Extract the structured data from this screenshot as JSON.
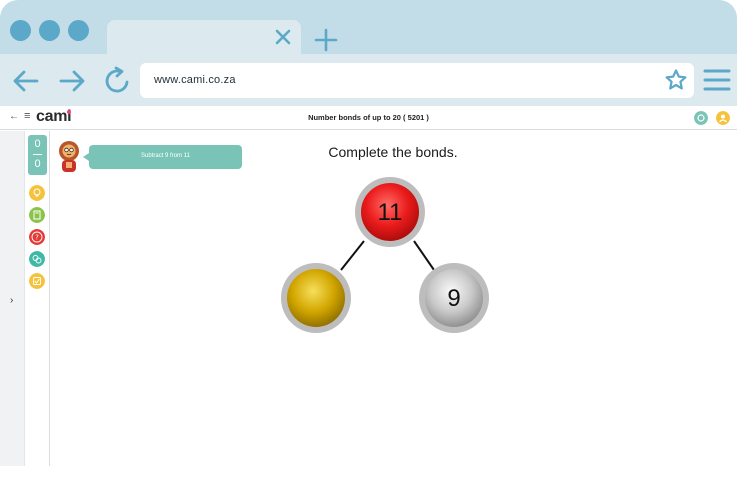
{
  "browser": {
    "url": "www.cami.co.za",
    "window_dots_color": "#5ba8c8"
  },
  "app": {
    "logo": "cami",
    "title": "Number bonds of up to 20 ( 5201 )",
    "score": {
      "correct": "0",
      "total": "0"
    },
    "hint": "Subtract 9 from 11",
    "instruction": "Complete the bonds."
  },
  "bond": {
    "whole": "11",
    "part_left": "",
    "part_right": "9",
    "colors": {
      "whole": "#e8161b",
      "left": "#d4a800",
      "right": "#c8c8c8"
    }
  },
  "tools": [
    {
      "icon": "lightbulb-icon",
      "color": "#f5c33b"
    },
    {
      "icon": "calculator-icon",
      "color": "#8bc34a"
    },
    {
      "icon": "help-icon",
      "color": "#e53935"
    },
    {
      "icon": "chat-icon",
      "color": "#3fb8a7"
    },
    {
      "icon": "check-icon",
      "color": "#f5c33b"
    }
  ]
}
